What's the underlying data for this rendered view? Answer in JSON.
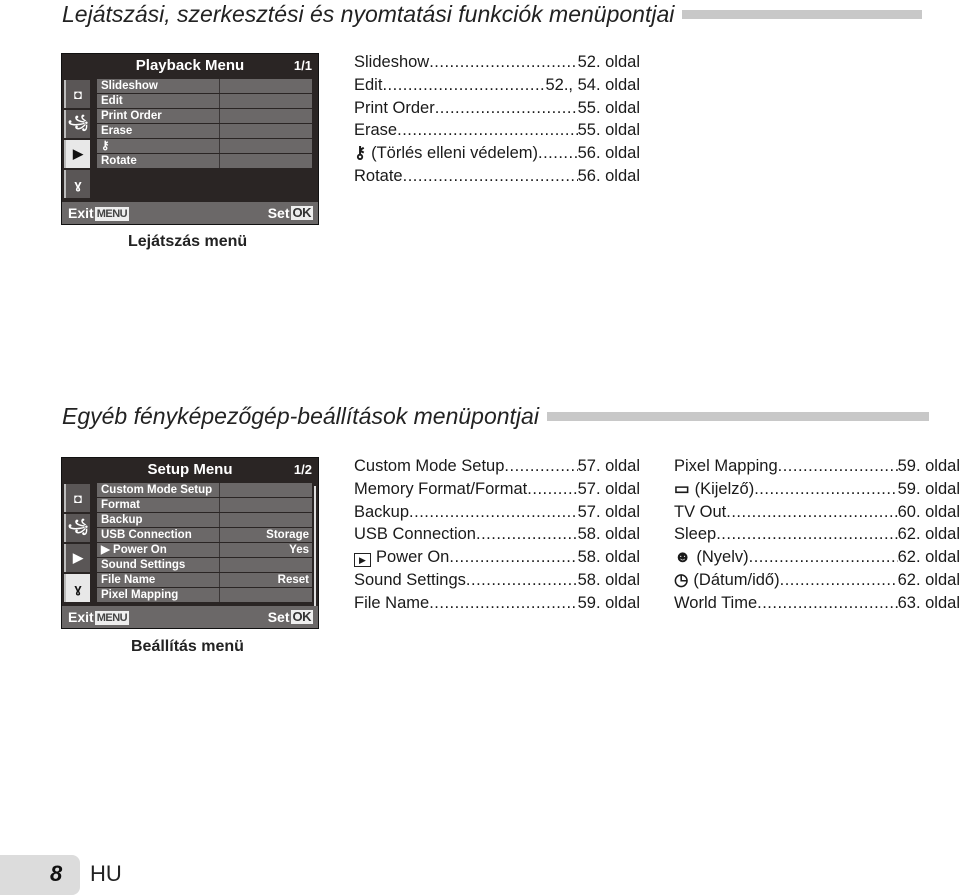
{
  "sections": {
    "playback": {
      "title": "Lejátszási, szerkesztési és nyomtatási funkciók menüpontjai",
      "screen": {
        "title": "Playback Menu",
        "page": "1/1",
        "tabs": [
          {
            "icon": "camera-icon",
            "glyph": "◘",
            "active": false
          },
          {
            "icon": "movie-icon",
            "glyph": "꧁",
            "active": false
          },
          {
            "icon": "playback-icon",
            "glyph": "▶",
            "active": true
          },
          {
            "icon": "wrench-icon",
            "glyph": "ɣ",
            "active": false
          }
        ],
        "rows": [
          {
            "label": "Slideshow",
            "value": ""
          },
          {
            "label": "Edit",
            "value": ""
          },
          {
            "label": "Print Order",
            "value": ""
          },
          {
            "label": "Erase",
            "value": ""
          },
          {
            "label": "⚷",
            "value": ""
          },
          {
            "label": "Rotate",
            "value": ""
          }
        ],
        "exit_label": "Exit",
        "exit_key": "MENU",
        "set_label": "Set",
        "set_key": "OK"
      },
      "caption": "Lejátszás menü",
      "references": [
        {
          "name": "Slideshow",
          "icon": "",
          "page": "52. oldal"
        },
        {
          "name": "Edit",
          "icon": "",
          "page": "52., 54. oldal"
        },
        {
          "name": "Print Order",
          "icon": "",
          "page": "55. oldal"
        },
        {
          "name": "Erase",
          "icon": "",
          "page": "55. oldal"
        },
        {
          "name": "(Törlés elleni védelem)",
          "icon": "protect-icon",
          "page": "56. oldal"
        },
        {
          "name": "Rotate",
          "icon": "",
          "page": "56. oldal"
        }
      ]
    },
    "setup": {
      "title": "Egyéb fényképezőgép-beállítások menüpontjai",
      "screen": {
        "title": "Setup Menu",
        "page": "1/2",
        "tabs": [
          {
            "icon": "camera-icon",
            "glyph": "◘",
            "active": false
          },
          {
            "icon": "movie-icon",
            "glyph": "꧁",
            "active": false
          },
          {
            "icon": "playback-icon",
            "glyph": "▶",
            "active": false
          },
          {
            "icon": "wrench-icon",
            "glyph": "ɣ",
            "active": true
          }
        ],
        "rows": [
          {
            "label": "Custom Mode Setup",
            "value": ""
          },
          {
            "label": "Format",
            "value": ""
          },
          {
            "label": "Backup",
            "value": ""
          },
          {
            "label": "USB Connection",
            "value": "Storage"
          },
          {
            "label": "▶ Power On",
            "value": "Yes"
          },
          {
            "label": "Sound Settings",
            "value": ""
          },
          {
            "label": "File Name",
            "value": "Reset"
          },
          {
            "label": "Pixel Mapping",
            "value": ""
          }
        ],
        "exit_label": "Exit",
        "exit_key": "MENU",
        "set_label": "Set",
        "set_key": "OK"
      },
      "caption": "Beállítás menü",
      "references_col1": [
        {
          "name": "Custom Mode Setup",
          "icon": "",
          "page": "57. oldal"
        },
        {
          "name": "Memory Format/Format",
          "icon": "",
          "page": "57. oldal"
        },
        {
          "name": "Backup",
          "icon": "",
          "page": "57. oldal"
        },
        {
          "name": "USB Connection",
          "icon": "",
          "page": "58. oldal"
        },
        {
          "name": "Power On",
          "icon": "playback-icon",
          "page": "58. oldal"
        },
        {
          "name": "Sound Settings",
          "icon": "",
          "page": "58. oldal"
        },
        {
          "name": "File Name",
          "icon": "",
          "page": "59. oldal"
        }
      ],
      "references_col2": [
        {
          "name": "Pixel Mapping",
          "icon": "",
          "page": "59. oldal"
        },
        {
          "name": "(Kijelző)",
          "icon": "monitor-icon",
          "page": "59. oldal"
        },
        {
          "name": "TV Out",
          "icon": "",
          "page": "60. oldal"
        },
        {
          "name": "Sleep",
          "icon": "",
          "page": "62. oldal"
        },
        {
          "name": "(Nyelv)",
          "icon": "language-icon",
          "page": "62. oldal"
        },
        {
          "name": "(Dátum/idő)",
          "icon": "clock-icon",
          "page": "62. oldal"
        },
        {
          "name": "World Time",
          "icon": "",
          "page": "63. oldal"
        }
      ]
    }
  },
  "footer": {
    "page_number": "8",
    "language": "HU"
  },
  "icon_glyphs": {
    "protect-icon": "⚷",
    "playback-icon": "▶",
    "monitor-icon": "▭",
    "language-icon": "☻",
    "clock-icon": "◷"
  }
}
